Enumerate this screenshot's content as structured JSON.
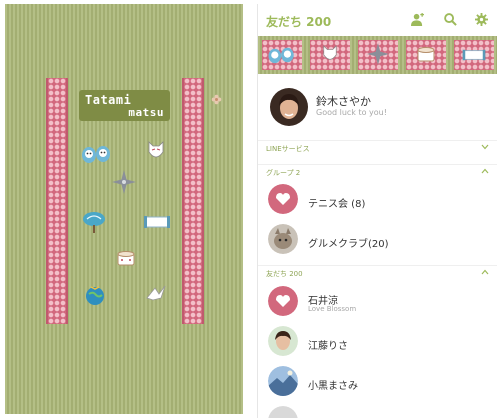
{
  "theme_preview": {
    "logo_title": "Tatami",
    "logo_subtitle": "matsu",
    "colors": {
      "tatami": "#a9b47a",
      "border": "#d2687d",
      "logo_box": "#7f8c45"
    }
  },
  "header": {
    "title": "友だち 200",
    "icons": [
      "add-friend-icon",
      "search-icon",
      "settings-icon"
    ],
    "accent": "#9dba5a"
  },
  "my_profile": {
    "name": "鈴木さやか",
    "status": "Good luck to you!"
  },
  "sections": {
    "line_services": "LINEサービス",
    "groups": "グループ 2",
    "friends": "友だち 200"
  },
  "groups": [
    {
      "name": "テニス会 (8)",
      "avatar": "pink-heart-icon"
    },
    {
      "name": "グルメクラブ(20)",
      "avatar": "cat-photo"
    }
  ],
  "friends": [
    {
      "name": "石井涼",
      "status": "Love Blossom",
      "avatar": "pink-heart-icon"
    },
    {
      "name": "江藤りさ",
      "status": "",
      "avatar": "portrait-photo"
    },
    {
      "name": "小黒まさみ",
      "status": "",
      "avatar": "landscape-photo"
    }
  ]
}
